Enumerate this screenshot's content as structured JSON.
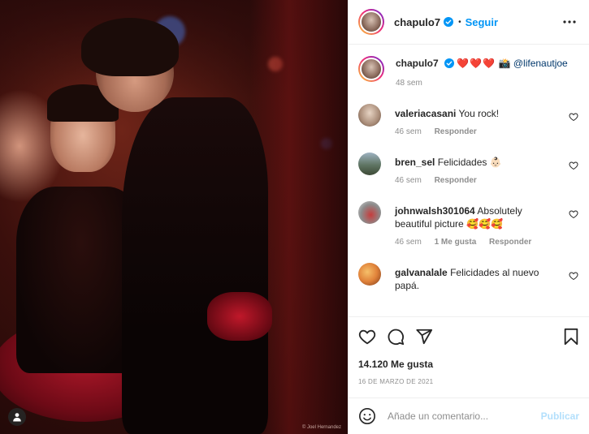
{
  "post": {
    "author": "chapulo7",
    "header_separator": "•",
    "follow_label": "Seguir",
    "photo_credit": "© Joel Hernandez",
    "caption": {
      "username": "chapulo7",
      "hearts": "❤️❤️❤️",
      "camera_emoji": "📸",
      "mention": "@lifenautjoe",
      "time": "48 sem"
    },
    "comments": [
      {
        "username": "valeriacasani",
        "text": "You rock!",
        "time": "46 sem",
        "likes": "",
        "reply_label": "Responder",
        "avatar_color": "#c8b3a2"
      },
      {
        "username": "bren_sel",
        "text": "Felicidades 👶🏻",
        "time": "46 sem",
        "likes": "",
        "reply_label": "Responder",
        "avatar_color": "#7f8f7a"
      },
      {
        "username": "johnwalsh301064",
        "text": "Absolutely beautiful picture 🥰🥰🥰",
        "time": "46 sem",
        "likes": "1 Me gusta",
        "reply_label": "Responder",
        "avatar_color": "#b23a3a"
      },
      {
        "username": "galvanalale",
        "text": "Felicidades al nuevo papá.",
        "time": "",
        "likes": "",
        "reply_label": "",
        "avatar_color": "#e0823a"
      }
    ],
    "likes_count": "14.120 Me gusta",
    "date": "16 DE MARZO DE 2021",
    "comment_placeholder": "Añade un comentario...",
    "publish_label": "Publicar"
  },
  "colors": {
    "accent": "#0095f6",
    "publish_disabled": "#b2dffc",
    "heart": "#ed4956",
    "muted": "#8e8e8e"
  },
  "icons": {
    "verified": "verified-badge-icon",
    "more": "more-options-icon",
    "like": "heart-icon",
    "comment": "comment-bubble-icon",
    "share": "paper-plane-icon",
    "save": "bookmark-icon",
    "emoji": "smiley-icon",
    "tagged": "person-tag-icon"
  }
}
